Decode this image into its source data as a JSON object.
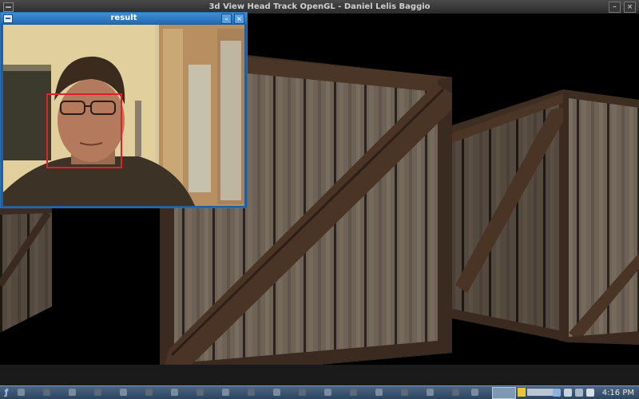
{
  "main_window": {
    "title": "3d View Head Track OpenGL - Daniel Lelis Baggio"
  },
  "result_window": {
    "title": "result"
  },
  "taskbar": {
    "clock": "4:16 PM"
  },
  "colors": {
    "face_box": "#e0202a",
    "result_title_bar": "#2f7dc6"
  },
  "icons": [
    "menu-icon",
    "minimize-icon",
    "close-icon",
    "start-icon"
  ]
}
